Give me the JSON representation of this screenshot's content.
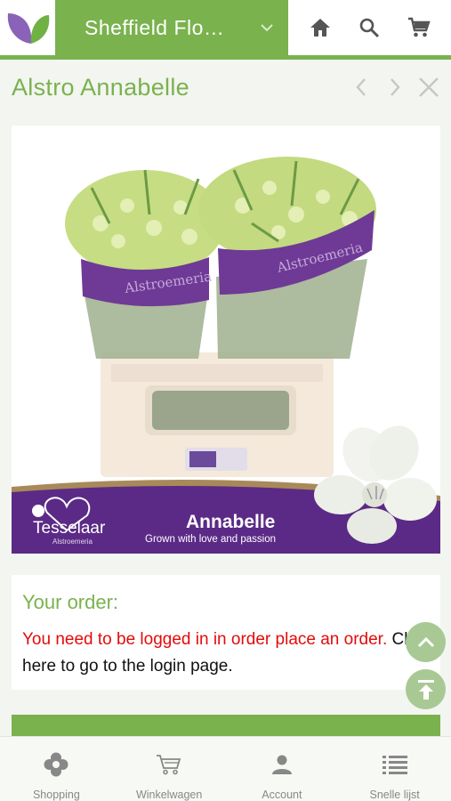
{
  "header": {
    "store_name": "Sheffield Flo…",
    "icons": [
      "leaf-logo",
      "chevron-down-icon",
      "home-icon",
      "search-icon",
      "cart-icon"
    ]
  },
  "product": {
    "title": "Alstro Annabelle",
    "image": {
      "brand": "Tesselaar",
      "brand_sub": "Alstroemeria",
      "variety": "Annabelle",
      "tagline": "Grown with love and passion",
      "sleeve_text": "Alstroemeria"
    }
  },
  "order": {
    "heading": "Your order:",
    "login_required": "You need to be logged in in order place an order.",
    "login_link": " Click here to go to the login page."
  },
  "bottom_nav": [
    {
      "label": "Shopping",
      "icon": "flower-icon"
    },
    {
      "label": "Winkelwagen",
      "icon": "cart-icon"
    },
    {
      "label": "Account",
      "icon": "person-icon"
    },
    {
      "label": "Snelle lijst",
      "icon": "list-icon"
    }
  ],
  "colors": {
    "accent": "#7ab24e",
    "warning": "#e30b0b",
    "brand_purple": "#5b2a86"
  }
}
